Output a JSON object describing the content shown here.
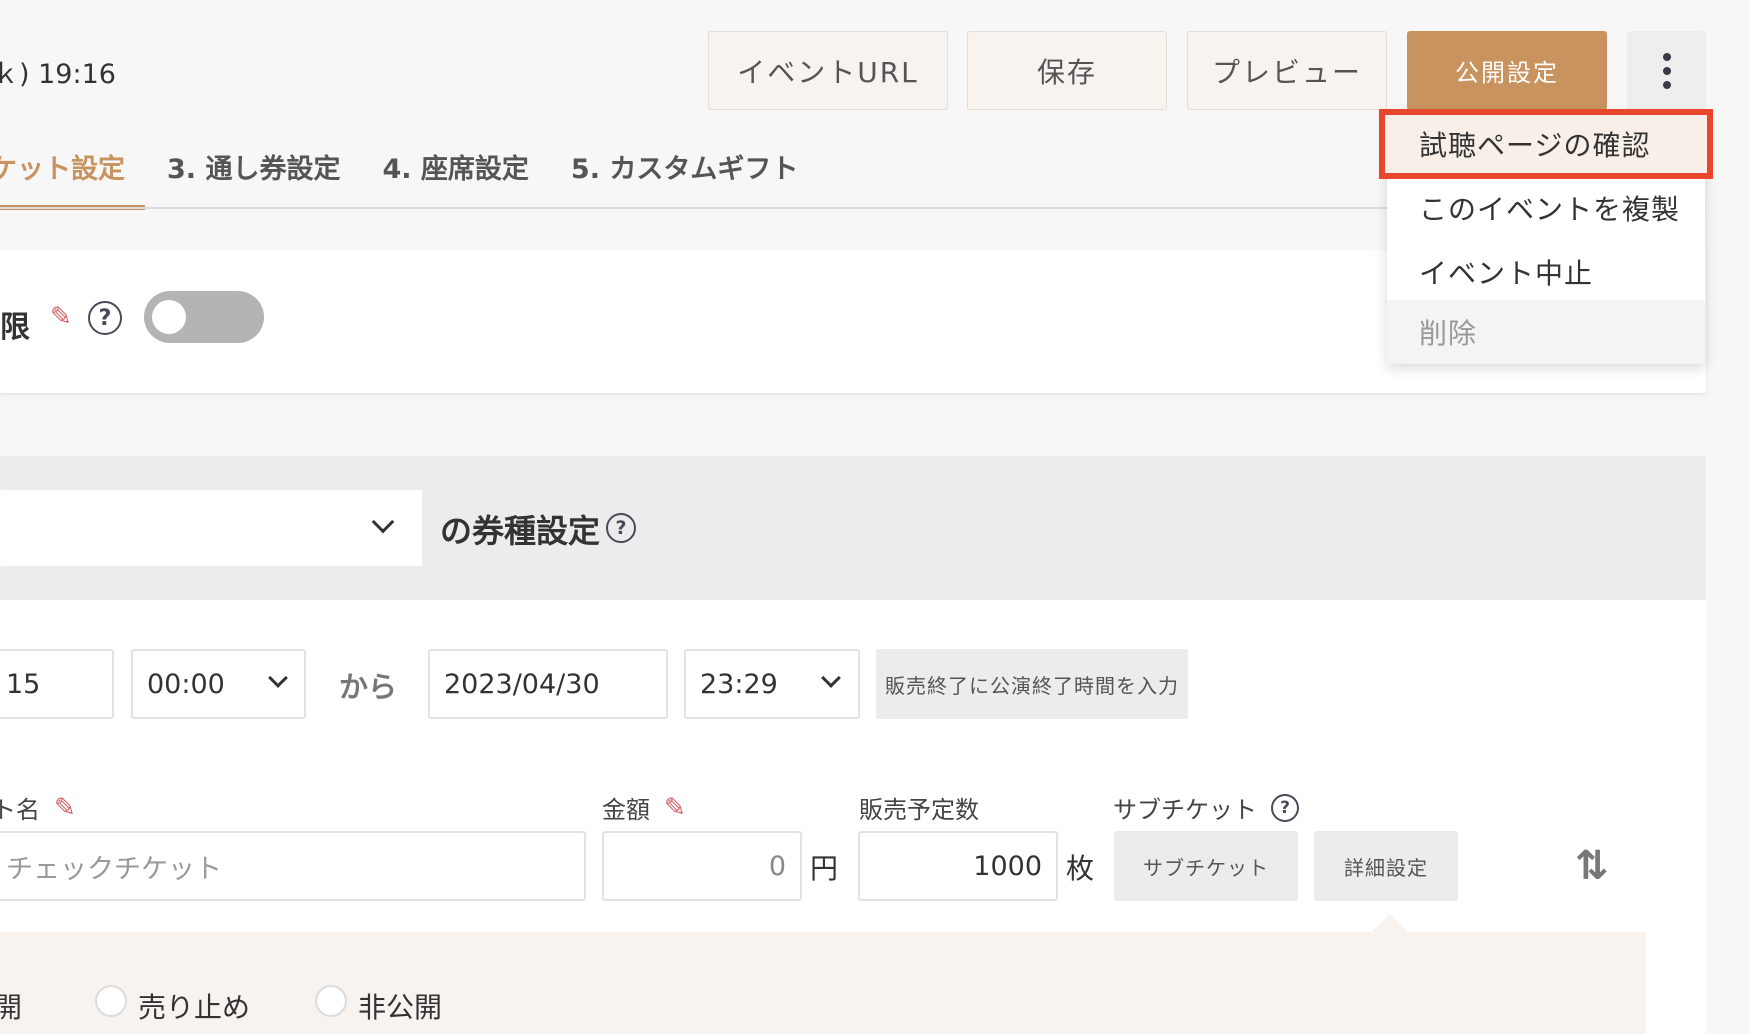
{
  "header": {
    "datetime": "ｋ) 19:16",
    "buttons": {
      "event_url": "イベントURL",
      "save": "保存",
      "preview": "プレビュー",
      "publish_settings": "公開設定"
    }
  },
  "tabs": [
    {
      "label": "ケット設定",
      "active": true
    },
    {
      "label": "3. 通し券設定"
    },
    {
      "label": "4. 座席設定"
    },
    {
      "label": "5. カスタムギフト"
    }
  ],
  "limit_section": {
    "label": "限",
    "help": "?",
    "toggle_on": false
  },
  "ticket_type": {
    "title": "の券種設定",
    "help": "?"
  },
  "sales_period": {
    "start_date": "15",
    "start_time": "00:00",
    "from_label": "から",
    "end_date": "2023/04/30",
    "end_time": "23:29",
    "end_at_show_button": "販売終了に公演終了時間を入力"
  },
  "ticket_fields": {
    "name_label": "ト名",
    "name_value": "チェックチケット",
    "price_label": "金額",
    "price_value": "0",
    "price_unit": "円",
    "quantity_label": "販売予定数",
    "quantity_value": "1000",
    "quantity_unit": "枚",
    "subticket_label": "サブチケット",
    "subticket_help": "?",
    "subticket_button": "サブチケット",
    "detail_button": "詳細設定",
    "sort_icon": "⇅"
  },
  "status_options": {
    "public": "開",
    "stop": "売り止め",
    "private": "非公開"
  },
  "menu": {
    "items": [
      "試聴ページの確認",
      "このイベントを複製",
      "イベント中止",
      "削除"
    ]
  },
  "colors": {
    "accent": "#c8935e",
    "highlight_border": "#e8472b"
  }
}
